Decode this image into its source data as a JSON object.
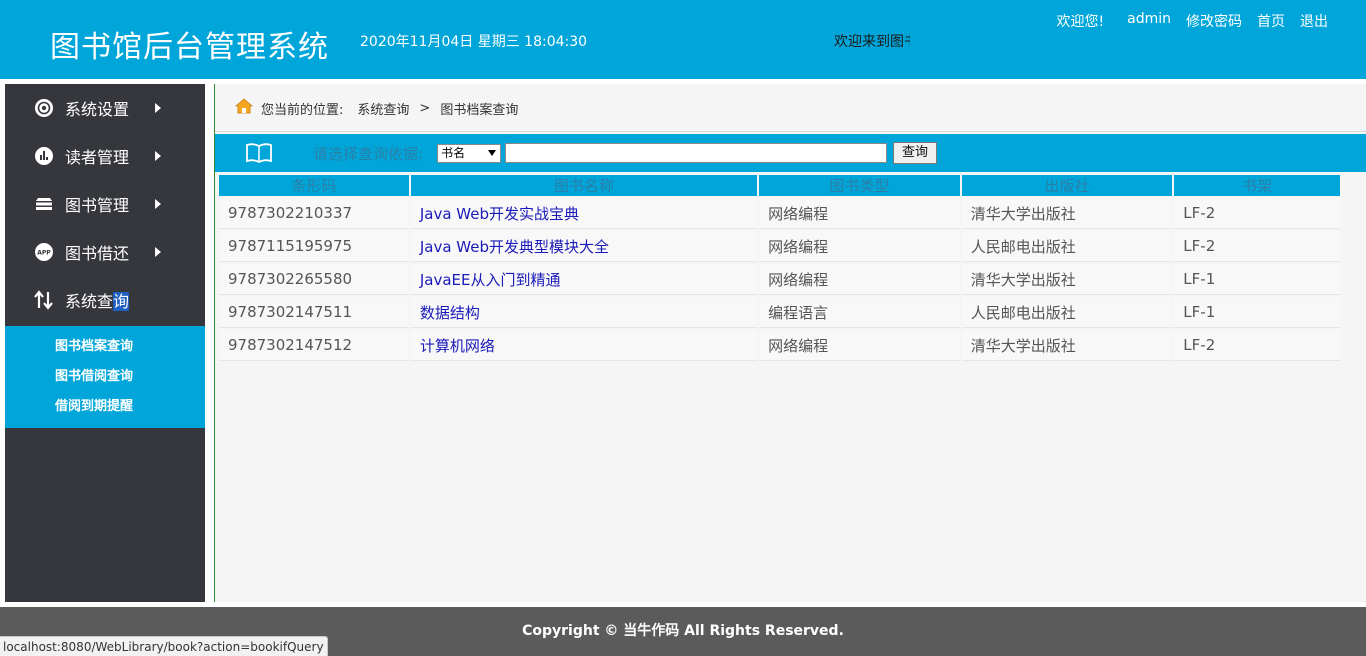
{
  "header": {
    "title": "图书馆后台管理系统",
    "datetime": "2020年11月04日 星期三 18:04:30",
    "marquee": "欢迎来到图书",
    "welcome": "欢迎您!",
    "user": "admin",
    "change_password": "修改密码",
    "home": "首页",
    "logout": "退出"
  },
  "sidebar": {
    "items": [
      {
        "label": "系统设置",
        "icon": "gear-icon"
      },
      {
        "label": "读者管理",
        "icon": "chart-icon"
      },
      {
        "label": "图书管理",
        "icon": "books-icon"
      },
      {
        "label": "图书借还",
        "icon": "app-icon"
      },
      {
        "label_main": "系统查",
        "label_sel": "询",
        "icon": "sort-arrows-icon"
      }
    ],
    "submenu": [
      "图书档案查询",
      "图书借阅查询",
      "借阅到期提醒"
    ]
  },
  "breadcrumb": {
    "prefix": "您当前的位置:",
    "section": "系统查询",
    "separator": ">",
    "page": "图书档案查询"
  },
  "search": {
    "label": "请选择查询依据:",
    "select_value": "书名",
    "input_value": "",
    "button": "查询"
  },
  "table": {
    "headers": [
      "条形码",
      "图书名称",
      "图书类型",
      "出版社",
      "书架"
    ],
    "rows": [
      [
        "9787302210337",
        "Java Web开发实战宝典",
        "网络编程",
        "清华大学出版社",
        "LF-2"
      ],
      [
        "9787115195975",
        "Java Web开发典型模块大全",
        "网络编程",
        "人民邮电出版社",
        "LF-2"
      ],
      [
        "9787302265580",
        "JavaEE从入门到精通",
        "网络编程",
        "清华大学出版社",
        "LF-1"
      ],
      [
        "9787302147511",
        "数据结构",
        "编程语言",
        "人民邮电出版社",
        "LF-1"
      ],
      [
        "9787302147512",
        "计算机网络",
        "网络编程",
        "清华大学出版社",
        "LF-2"
      ]
    ]
  },
  "footer": {
    "copyright": "Copyright © 当牛作码 All Rights Reserved."
  },
  "statusbar": {
    "url": "localhost:8080/WebLibrary/book?action=bookifQuery"
  },
  "colors": {
    "accent": "#00a6d9",
    "sidebar": "#35373d",
    "footer": "#5b5b5b",
    "link": "#1a1ab8"
  }
}
